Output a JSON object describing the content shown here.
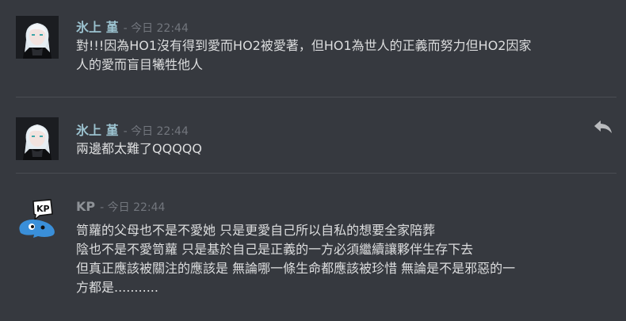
{
  "messages": [
    {
      "author": "氷上 堇",
      "timestamp": "- 今日 22:44",
      "lines": [
        "對!!!因為HO1沒有得到愛而HO2被愛著，但HO1為世人的正義而努力但HO2因家",
        "人的愛而盲目犧牲他人"
      ]
    },
    {
      "author": "氷上 堇",
      "timestamp": "- 今日 22:44",
      "lines": [
        "兩邊都太難了QQQQQ"
      ],
      "icon": "reply-icon"
    },
    {
      "author": "KP",
      "timestamp": "- 今日 22:44",
      "lines": [
        "笥蘿的父母也不是不愛她 只是更愛自己所以自私的想要全家陪葬",
        "陰也不是不愛笥蘿 只是基於自己是正義的一方必須繼續讓夥伴生存下去",
        "但真正應該被關注的應該是 無論哪一條生命都應該被珍惜 無論是不是邪惡的一",
        "方都是..........."
      ],
      "avatar_label": "KP"
    }
  ],
  "colors": {
    "background": "#36393f",
    "author_highlight": "#9bc2cf",
    "author_plain": "#8e9297",
    "timestamp": "#72767d",
    "text": "#dcddde"
  }
}
